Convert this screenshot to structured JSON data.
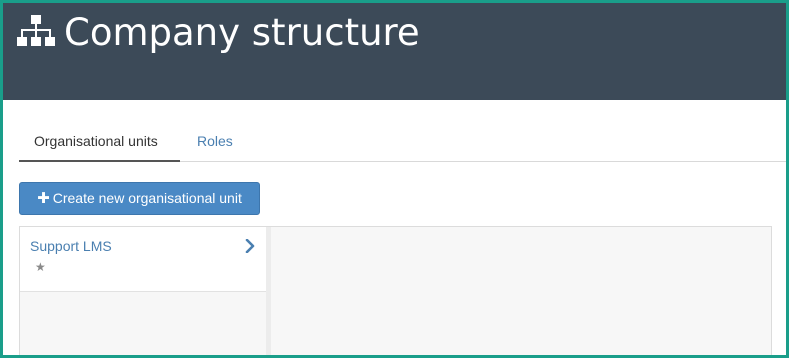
{
  "header": {
    "title": "Company structure",
    "icon": "sitemap-icon"
  },
  "tabs": [
    {
      "label": "Organisational units",
      "active": true
    },
    {
      "label": "Roles",
      "active": false
    }
  ],
  "create_button": {
    "icon": "plus-icon",
    "label": "Create new organisational unit"
  },
  "units": [
    {
      "label": "Support LMS",
      "star_icon": "star-icon",
      "chevron_icon": "chevron-right-icon"
    }
  ],
  "colors": {
    "header_bg": "#3c4a58",
    "primary": "#4a89c5",
    "link": "#4a7fb0",
    "frame_border": "#1a9e8a"
  }
}
